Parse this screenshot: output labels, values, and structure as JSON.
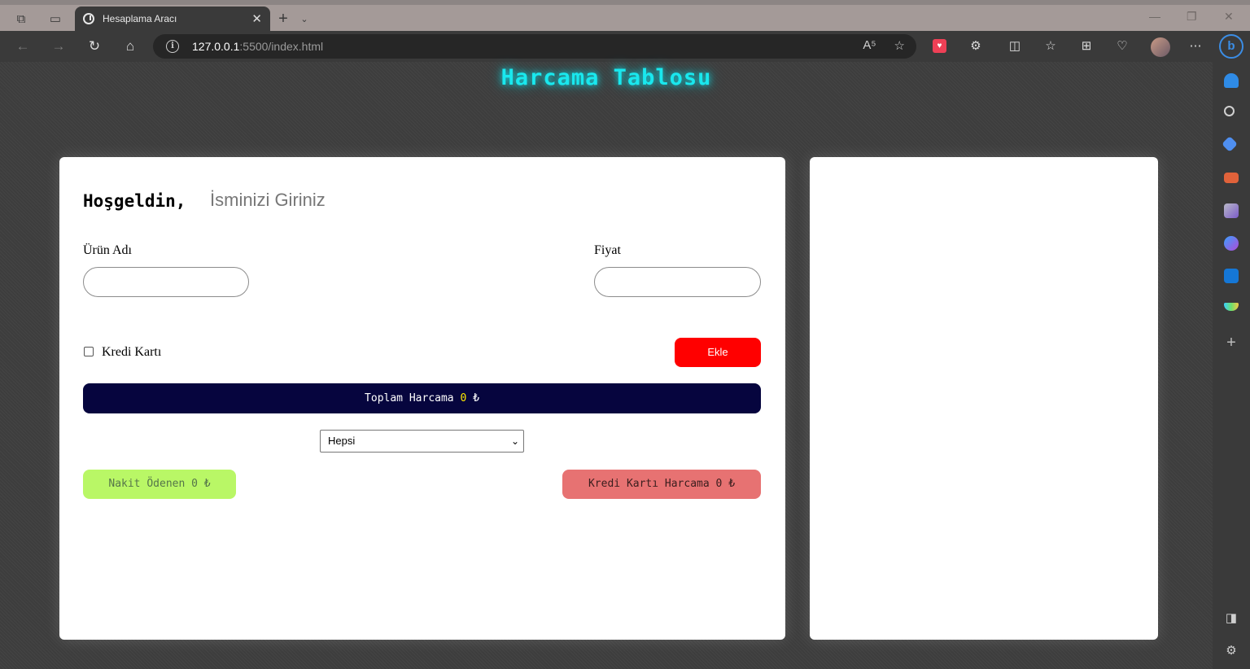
{
  "browser": {
    "tab_title": "Hesaplama Aracı",
    "url_host": "127.0.0.1",
    "url_path": ":5500/index.html",
    "read_aloud_label": "A⁵"
  },
  "page": {
    "title": "Harcama Tablosu",
    "welcome_label": "Hoşgeldin,",
    "name_placeholder": "İsminizi Giriniz",
    "product_label": "Ürün Adı",
    "price_label": "Fiyat",
    "credit_card_label": "Kredi Kartı",
    "add_button": "Ekle",
    "total_label": "Toplam Harcama",
    "total_value": "0",
    "currency": "₺",
    "filter_selected": "Hepsi",
    "cash_paid_label": "Nakit Ödenen",
    "cash_paid_value": "0",
    "credit_spend_label": "Kredi Kartı Harcama",
    "credit_spend_value": "0"
  },
  "colors": {
    "title_glow": "#19e8ee",
    "add_button": "#ff0000",
    "total_bar": "#06053e",
    "total_value": "#ffea00",
    "cash_box": "#b9f766",
    "card_box": "#e77272"
  },
  "sidebar_icons": [
    "bell-icon",
    "search-icon",
    "tag-icon",
    "toolbox-icon",
    "games-icon",
    "office-icon",
    "outlook-icon",
    "drop-icon",
    "add-icon",
    "sidebar-toggle-icon",
    "settings-icon"
  ]
}
